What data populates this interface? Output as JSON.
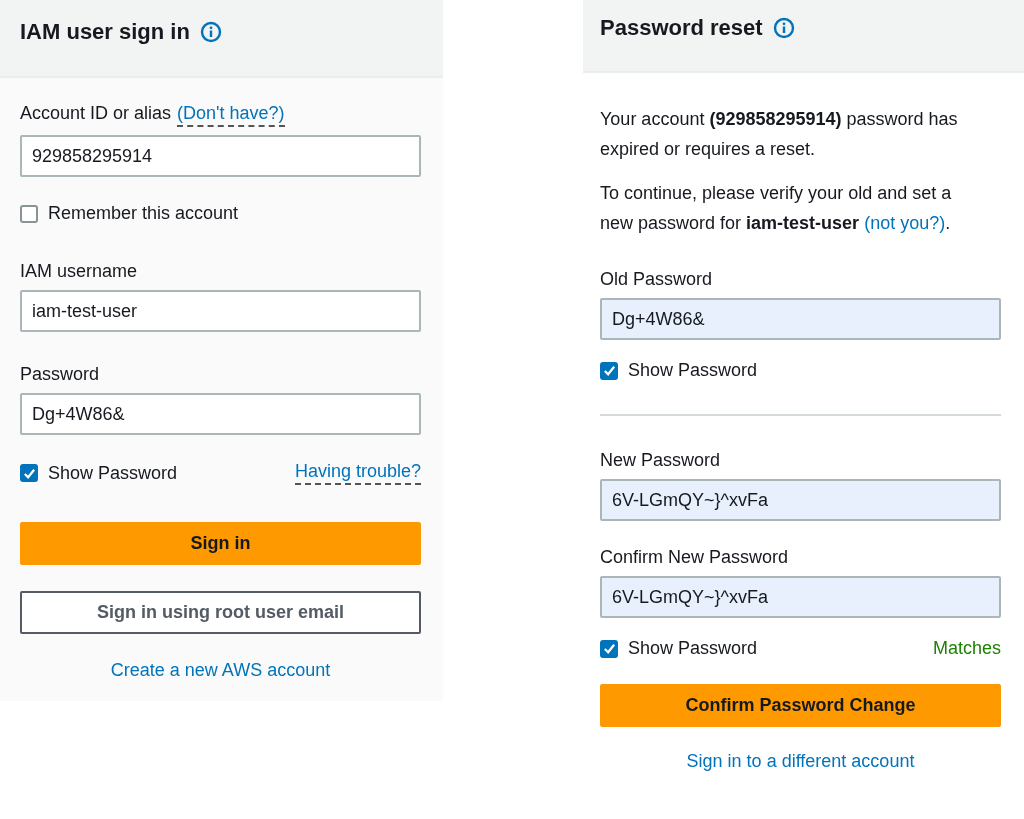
{
  "panels": [
    {
      "title": "IAM user sign in",
      "items": [
        {
          "kind": "field",
          "label": "Account ID or alias",
          "label_link": "(Don't have?)",
          "value": "929858295914",
          "autofilled": false
        },
        {
          "kind": "checkbox",
          "label": "Remember this account",
          "checked": false
        },
        {
          "kind": "field",
          "label": "IAM username",
          "value": "iam-test-user",
          "autofilled": false
        },
        {
          "kind": "field",
          "label": "Password",
          "value": "Dg+4W86&",
          "autofilled": false
        },
        {
          "kind": "checkbox",
          "label": "Show Password",
          "checked": true,
          "link": "Having trouble?"
        },
        {
          "kind": "button",
          "label": "Sign in",
          "primary": true
        },
        {
          "kind": "button",
          "label": "Sign in using root user email",
          "primary": false
        },
        {
          "kind": "link",
          "label": "Create a new AWS account"
        }
      ]
    },
    {
      "title": "Password reset",
      "items": [
        {
          "kind": "paragraph",
          "text": "Your account **(929858295914)** password has expired or requires a reset."
        },
        {
          "kind": "paragraph",
          "text": "To continue, please verify your old and set a new password for **iam-test-user**",
          "link": "(not you?)",
          "after": "."
        },
        {
          "kind": "field",
          "label": "Old Password",
          "value": "Dg+4W86&",
          "autofilled": true
        },
        {
          "kind": "checkbox",
          "label": "Show Password",
          "checked": true
        },
        {
          "kind": "divider"
        },
        {
          "kind": "field",
          "label": "New Password",
          "value": "6V-LGmQY~}^xvFa",
          "autofilled": true
        },
        {
          "kind": "field",
          "label": "Confirm New Password",
          "value": "6V-LGmQY~}^xvFa",
          "autofilled": true
        },
        {
          "kind": "checkbox",
          "label": "Show Password",
          "checked": true,
          "status": "Matches"
        },
        {
          "kind": "button",
          "label": "Confirm Password Change",
          "primary": true
        },
        {
          "kind": "link",
          "label": "Sign in to a different account"
        }
      ]
    }
  ]
}
